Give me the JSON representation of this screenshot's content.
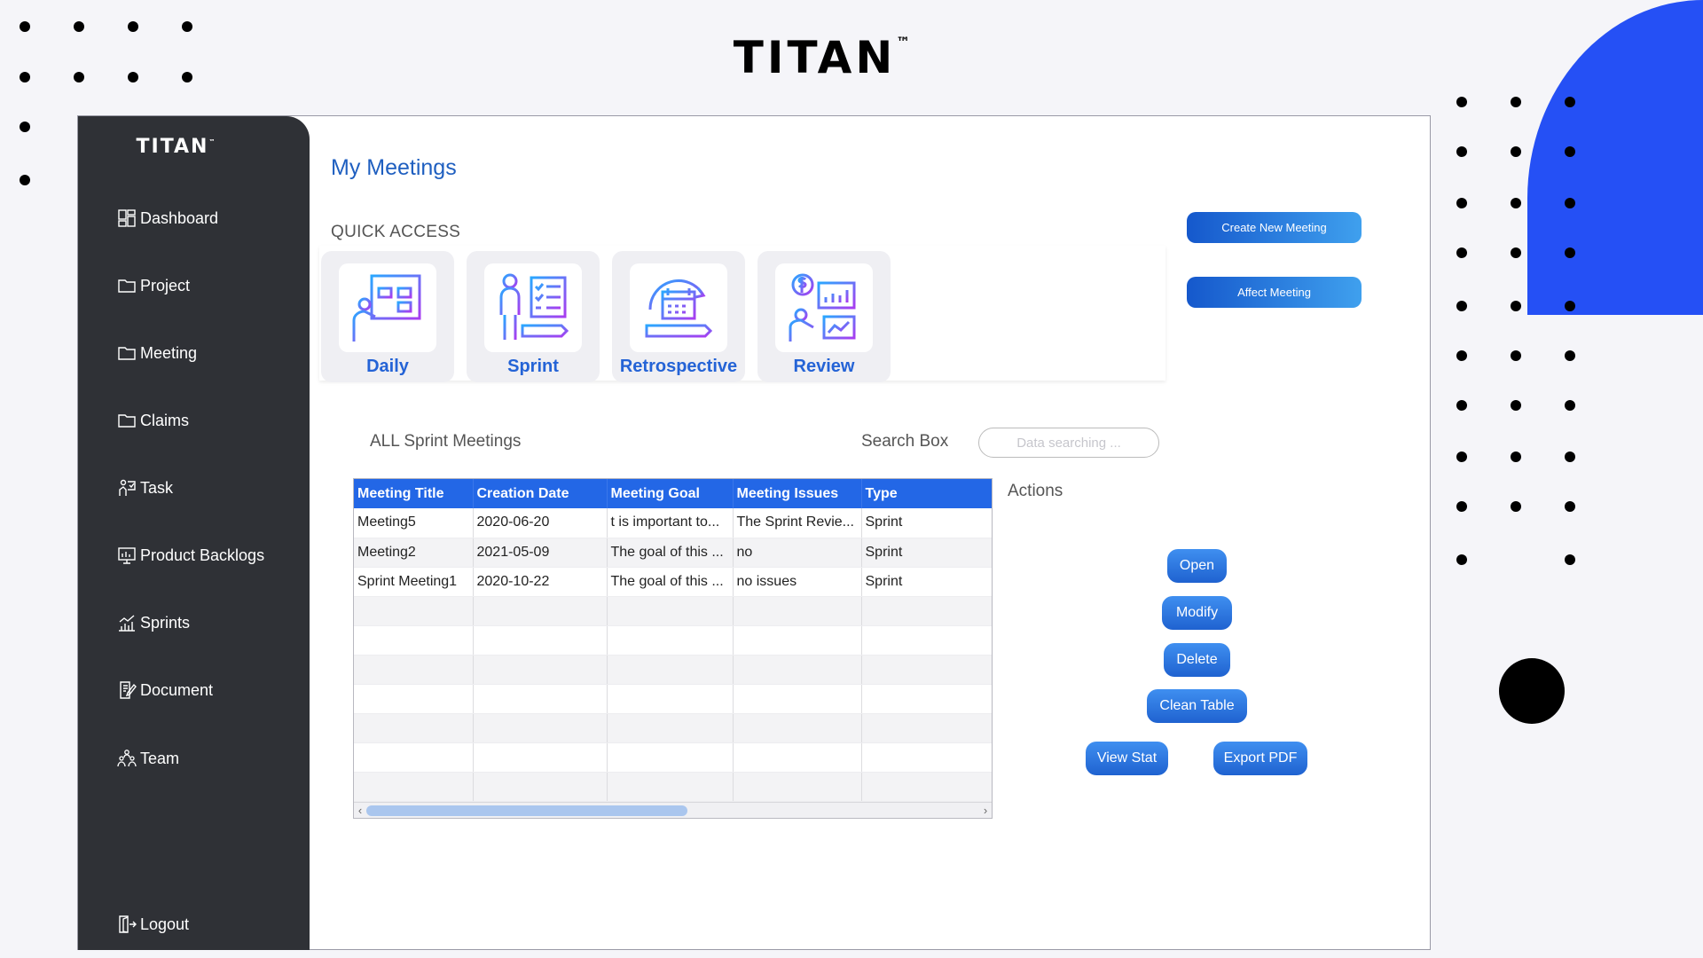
{
  "brand": {
    "name": "TITAN",
    "tm": "™"
  },
  "sidebar": {
    "brand": "TITAN",
    "tm": "™",
    "items": [
      {
        "label": "Dashboard",
        "icon": "dashboard-icon"
      },
      {
        "label": "Project",
        "icon": "folder-icon"
      },
      {
        "label": "Meeting",
        "icon": "folder-icon"
      },
      {
        "label": "Claims",
        "icon": "folder-icon"
      },
      {
        "label": "Task",
        "icon": "task-icon"
      },
      {
        "label": "Product Backlogs",
        "icon": "backlog-icon"
      },
      {
        "label": "Sprints",
        "icon": "sprints-chart-icon"
      },
      {
        "label": "Document",
        "icon": "document-icon"
      },
      {
        "label": "Team",
        "icon": "team-icon"
      }
    ],
    "logout": {
      "label": "Logout",
      "icon": "logout-icon"
    }
  },
  "main": {
    "title": "My Meetings",
    "quick_access": {
      "label": "QUICK ACCESS",
      "cards": [
        {
          "label": "Daily",
          "icon": "daily-board-icon"
        },
        {
          "label": "Sprint",
          "icon": "sprint-checklist-icon"
        },
        {
          "label": "Retrospective",
          "icon": "retrospective-calendar-icon"
        },
        {
          "label": "Review",
          "icon": "review-stats-icon"
        }
      ]
    },
    "buttons": {
      "create": "Create New Meeting",
      "affect": "Affect Meeting"
    },
    "list_title": "ALL Sprint Meetings",
    "search": {
      "label": "Search Box",
      "placeholder": "Data searching ..."
    },
    "table": {
      "columns": [
        "Meeting Title",
        "Creation Date",
        "Meeting Goal",
        "Meeting Issues",
        "Type"
      ],
      "rows": [
        [
          "Meeting5",
          "2020-06-20",
          "t is important to...",
          "The Sprint Revie...",
          "Sprint"
        ],
        [
          "Meeting2",
          "2021-05-09",
          "The goal of this ...",
          "no",
          "Sprint"
        ],
        [
          "Sprint Meeting1",
          "2020-10-22",
          "The goal of this ...",
          "no issues",
          "Sprint"
        ]
      ],
      "scroll_left": "‹",
      "scroll_right": "›"
    },
    "actions": {
      "label": "Actions",
      "open": "Open",
      "modify": "Modify",
      "delete": "Delete",
      "clean": "Clean Table",
      "view_stat": "View Stat",
      "export_pdf": "Export PDF"
    }
  },
  "colors": {
    "accent": "#2367e6",
    "title": "#1f5fc0",
    "sidebar": "#2f3136",
    "blob": "#2550f5"
  }
}
